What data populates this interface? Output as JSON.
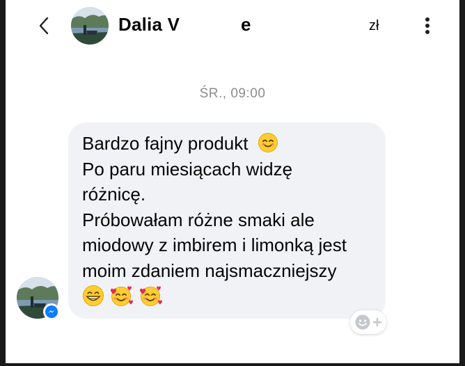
{
  "header": {
    "contact_name": "Dalia V",
    "contact_name_suffix": "e",
    "currency": "zł"
  },
  "timestamp": "ŚR., 09:00",
  "message": {
    "lines": [
      "Bardzo fajny produkt",
      "Po paru miesiącach widzę",
      "różnicę.",
      "Próbowałam różne smaki ale",
      "miodowy z imbirem i limonką jest",
      "moim zdaniem najsmaczniejszy"
    ],
    "inline_emoji_1": "smiling-face-icon",
    "trailing_emojis": [
      "grinning-face-icon",
      "smiling-face-with-hearts-icon",
      "smiling-face-with-hearts-icon"
    ]
  },
  "colors": {
    "bubble_bg": "#f0f2f5",
    "timestamp": "#8a8d91",
    "text": "#050505",
    "messenger_blue": "#0a7cff"
  }
}
